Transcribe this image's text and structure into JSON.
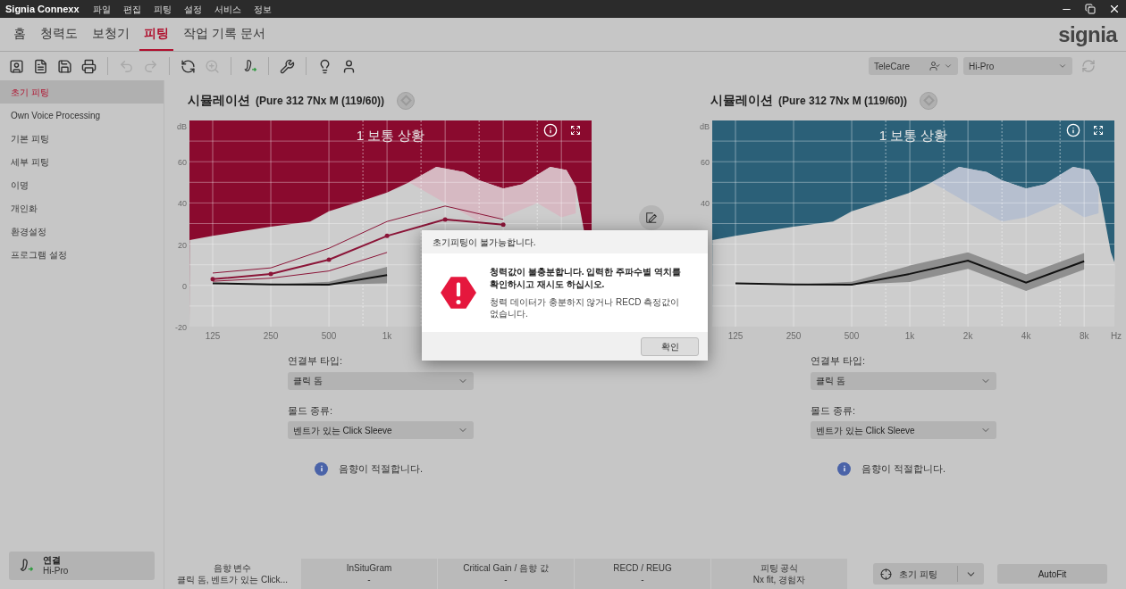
{
  "title_bar": {
    "app_name": "Signia Connexx",
    "menu": [
      "파일",
      "편집",
      "피팅",
      "설정",
      "서비스",
      "정보"
    ]
  },
  "nav_tabs": [
    {
      "label": "홈",
      "selected": false
    },
    {
      "label": "청력도",
      "selected": false
    },
    {
      "label": "보청기",
      "selected": false
    },
    {
      "label": "피팅",
      "selected": true
    },
    {
      "label": "작업 기록 문서",
      "selected": false
    }
  ],
  "logo": "signia",
  "toolbar": [
    {
      "disabled": false
    },
    {
      "disabled": false
    },
    {
      "disabled": false
    },
    {
      "disabled": false
    },
    {
      "disabled": true
    },
    {
      "disabled": true
    },
    {
      "disabled": false
    },
    {
      "disabled": true
    },
    {
      "disabled": false
    },
    {
      "disabled": false
    },
    {
      "disabled": false
    },
    {
      "disabled": false
    }
  ],
  "telecare": {
    "label": "TeleCare"
  },
  "device_select": {
    "value": "Hi-Pro"
  },
  "sidebar": {
    "items": [
      {
        "label": "초기 피팅",
        "selected": true
      },
      {
        "label": "Own Voice Processing",
        "selected": false
      },
      {
        "label": "기본 피팅",
        "selected": false
      },
      {
        "label": "세부 피팅",
        "selected": false
      },
      {
        "label": "이명",
        "selected": false
      },
      {
        "label": "개인화",
        "selected": false
      },
      {
        "label": "환경설정",
        "selected": false
      },
      {
        "label": "프로그램 설정",
        "selected": false
      }
    ],
    "connection": {
      "label": "연결",
      "device": "Hi-Pro"
    }
  },
  "panels": [
    {
      "title": "시뮬레이션",
      "model": "(Pure 312 7Nx M (119/60))",
      "scene": "1 보통 상황",
      "color": "#8a0a2e",
      "chart_data": {
        "type": "line",
        "ylabel": "dB",
        "categories": [
          "125",
          "250",
          "500",
          "1k",
          null,
          null,
          null
        ],
        "ylim": [
          -20,
          80
        ],
        "grid": true,
        "yticks": [
          60,
          40,
          20,
          0,
          -20
        ],
        "series": [
          {
            "color": "#8b1538",
            "values": [
              3,
              5.5,
              12.5,
              24,
              32,
              29.5,
              null
            ]
          },
          {
            "color": "#8b1538",
            "values": [
              6,
              8.5,
              18,
              31,
              38.5,
              32,
              null
            ]
          },
          {
            "color": "#8b1538",
            "values": [
              2,
              3.5,
              7,
              16,
              null,
              null,
              null
            ]
          },
          {
            "color": "#111111",
            "values": [
              1,
              0.5,
              0.3,
              5,
              null,
              null,
              null
            ]
          }
        ]
      },
      "fields": [
        {
          "label": "연결부 타입:",
          "value": "클릭 돔"
        },
        {
          "label": "몰드 종류:",
          "value": "벤트가 있는 Click Sleeve"
        }
      ],
      "status": "음향이 적절합니다."
    },
    {
      "title": "시뮬레이션",
      "model": "(Pure 312 7Nx M (119/60))",
      "scene": "1 보통 상황",
      "color": "#2b6078",
      "chart_data": {
        "type": "line",
        "ylabel": "dB",
        "xlabel": "Hz",
        "categories": [
          "125",
          "250",
          "500",
          "1k",
          "2k",
          "4k",
          "8k"
        ],
        "ylim": [
          -20,
          80
        ],
        "grid": true,
        "yticks": [
          60,
          40
        ],
        "series": [
          {
            "color": "#111111",
            "values": [
              1,
              0.5,
              0.3,
              5.6,
              12,
              1.3,
              11.7
            ]
          }
        ]
      },
      "fields": [
        {
          "label": "연결부 타입:",
          "value": "클릭 돔"
        },
        {
          "label": "몰드 종류:",
          "value": "벤트가 있는 Click Sleeve"
        }
      ],
      "status": "음향이 적절합니다."
    }
  ],
  "bottom_tabs": [
    {
      "title": "음향 변수",
      "value": "클릭 돔, 벤트가 있는 Click...",
      "selected": true
    },
    {
      "title": "InSituGram",
      "value": "-",
      "selected": false
    },
    {
      "title": "Critical Gain / 음향 값",
      "value": "-",
      "selected": false
    },
    {
      "title": "RECD / REUG",
      "value": "-",
      "selected": false
    },
    {
      "title": "피팅 공식",
      "value": "Nx fit, 경험자",
      "selected": false
    }
  ],
  "initial_fit_button": "초기 피팅",
  "autofit_button": "AutoFit",
  "dialog": {
    "title": "초기피팅이 불가능합니다.",
    "message": "청력값이 불충분합니다. 입력한 주파수별 역치를 확인하시고 재시도 하십시오.",
    "detail": "청력 데이터가 충분하지 않거나 RECD 측정값이 없습니다.",
    "ok": "확인"
  }
}
